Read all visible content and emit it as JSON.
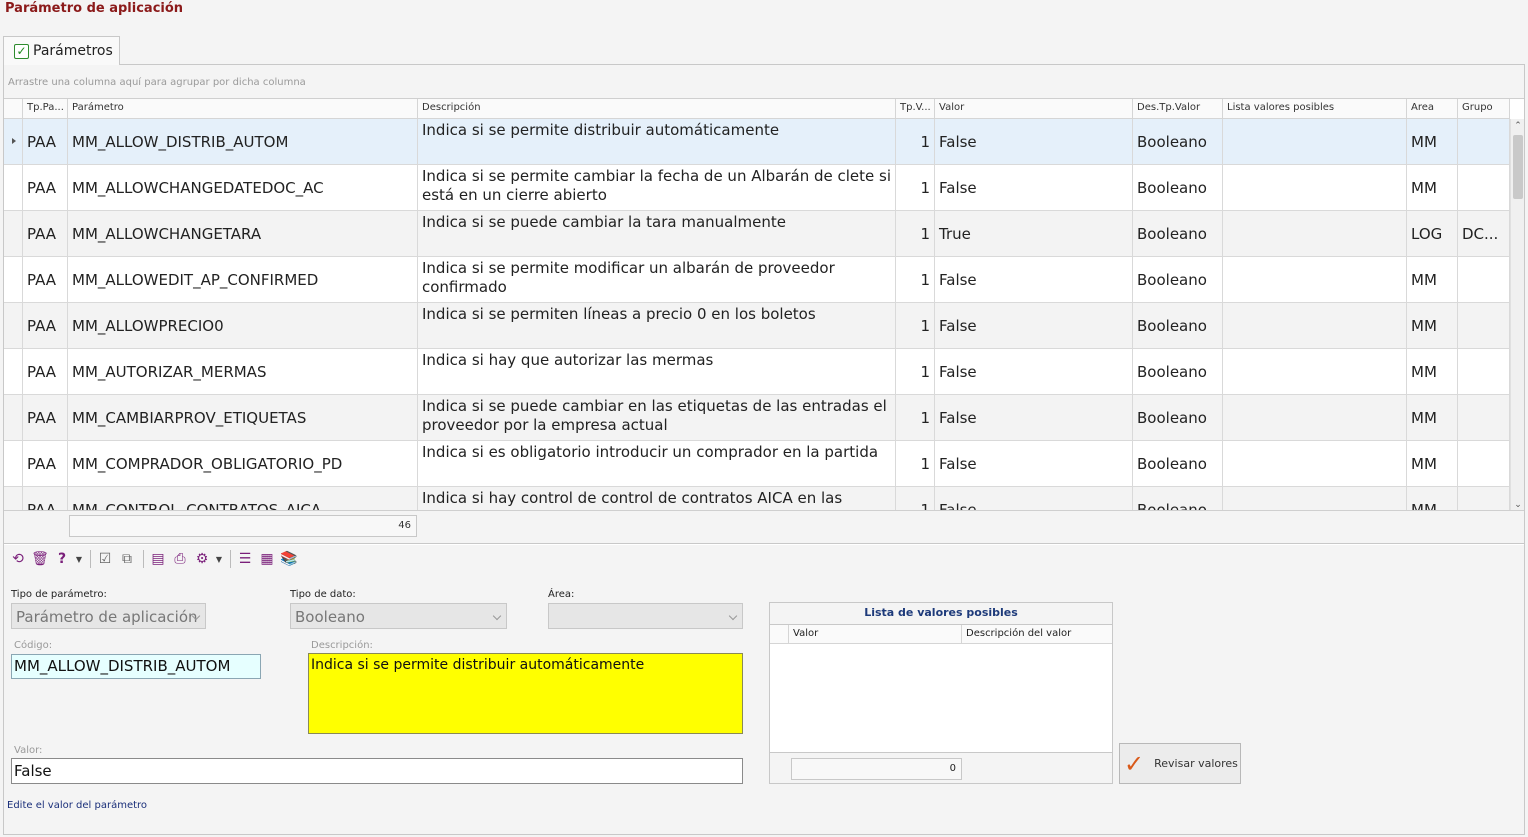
{
  "window": {
    "title": "Parámetro de aplicación"
  },
  "tab": {
    "label": "Parámetros"
  },
  "grid": {
    "group_hint": "Arrastre una columna aquí para agrupar por dicha columna",
    "columns": [
      "Tp.Pa...",
      "Parámetro",
      "Descripción",
      "Tp.V...",
      "Valor",
      "Des.Tp.Valor",
      "Lista valores posibles",
      "Area",
      "Grupo"
    ],
    "rows": [
      {
        "tp": "PAA",
        "param": "MM_ALLOW_DISTRIB_AUTOM",
        "desc": "Indica si se permite distribuir automáticamente",
        "tpv": "1",
        "valor": "False",
        "destp": "Booleano",
        "lista": "",
        "area": "MM",
        "grupo": ""
      },
      {
        "tp": "PAA",
        "param": "MM_ALLOWCHANGEDATEDOC_AC",
        "desc": "Indica si se permite cambiar la fecha de un Albarán de clete si está en un cierre abierto",
        "tpv": "1",
        "valor": "False",
        "destp": "Booleano",
        "lista": "",
        "area": "MM",
        "grupo": ""
      },
      {
        "tp": "PAA",
        "param": "MM_ALLOWCHANGETARA",
        "desc": "Indica si se puede cambiar la tara manualmente",
        "tpv": "1",
        "valor": "True",
        "destp": "Booleano",
        "lista": "",
        "area": "LOG",
        "grupo": "DC..."
      },
      {
        "tp": "PAA",
        "param": "MM_ALLOWEDIT_AP_CONFIRMED",
        "desc": "Indica si se permite modificar un albarán de proveedor confirmado",
        "tpv": "1",
        "valor": "False",
        "destp": "Booleano",
        "lista": "",
        "area": "MM",
        "grupo": ""
      },
      {
        "tp": "PAA",
        "param": "MM_ALLOWPRECIO0",
        "desc": "Indica si se permiten líneas a precio 0 en los boletos",
        "tpv": "1",
        "valor": "False",
        "destp": "Booleano",
        "lista": "",
        "area": "MM",
        "grupo": ""
      },
      {
        "tp": "PAA",
        "param": "MM_AUTORIZAR_MERMAS",
        "desc": "Indica si hay que autorizar las mermas",
        "tpv": "1",
        "valor": "False",
        "destp": "Booleano",
        "lista": "",
        "area": "MM",
        "grupo": ""
      },
      {
        "tp": "PAA",
        "param": "MM_CAMBIARPROV_ETIQUETAS",
        "desc": "Indica si se puede cambiar en las etiquetas de las entradas el proveedor por la empresa actual",
        "tpv": "1",
        "valor": "False",
        "destp": "Booleano",
        "lista": "",
        "area": "MM",
        "grupo": ""
      },
      {
        "tp": "PAA",
        "param": "MM_COMPRADOR_OBLIGATORIO_PD",
        "desc": "Indica si es obligatorio introducir un comprador en la partida",
        "tpv": "1",
        "valor": "False",
        "destp": "Booleano",
        "lista": "",
        "area": "MM",
        "grupo": ""
      },
      {
        "tp": "PAA",
        "param": "MM_CONTROL_CONTRATOS_AICA",
        "desc": "Indica si hay control de control de contratos AICA en las entradas",
        "tpv": "1",
        "valor": "False",
        "destp": "Booleano",
        "lista": "",
        "area": "MM",
        "grupo": ""
      }
    ],
    "count": "46"
  },
  "toolbar": {
    "icons": [
      "refresh-icon",
      "delete-icon",
      "help-icon",
      "dropdown-icon",
      "accept-icon",
      "export-icon",
      "document-icon",
      "print-icon",
      "settings-icon",
      "dropdown-icon",
      "list-icon",
      "calculator-icon",
      "books-icon"
    ]
  },
  "form": {
    "tipo_parametro_label": "Tipo de parámetro:",
    "tipo_parametro_value": "Parámetro de aplicación",
    "tipo_dato_label": "Tipo de dato:",
    "tipo_dato_value": "Booleano",
    "area_label": "Área:",
    "area_value": "",
    "codigo_label": "Código:",
    "codigo_value": "MM_ALLOW_DISTRIB_AUTOM",
    "descripcion_label": "Descripción:",
    "descripcion_value": "Indica si se permite distribuir automáticamente",
    "valor_label": "Valor:",
    "valor_value": "False",
    "hint": "Edite el valor del parámetro"
  },
  "lista_valores": {
    "title": "Lista de valores posibles",
    "col_valor": "Valor",
    "col_desc": "Descripción del valor",
    "count": "0"
  },
  "revisar": {
    "label": "Revisar valores"
  },
  "colors": {
    "title": "#8b1a1a",
    "selected_row": "#e5f0fa",
    "desc_bg": "#ffff00",
    "code_bg": "#e6ffff"
  }
}
